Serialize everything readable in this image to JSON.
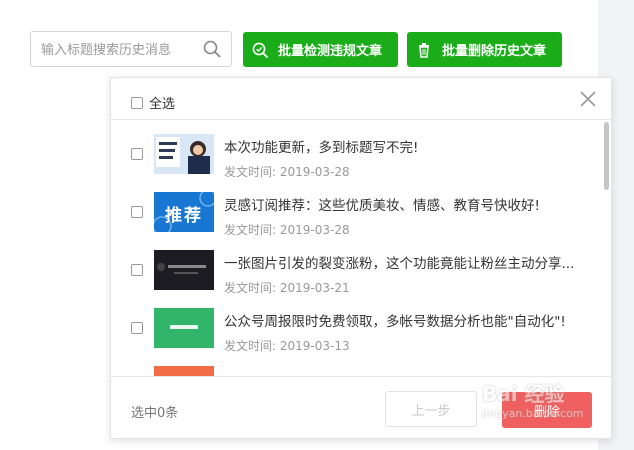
{
  "search": {
    "placeholder": "输入标题搜索历史消息"
  },
  "toolbar": {
    "detect_label": "批量检测违规文章",
    "delete_label": "批量删除历史文章"
  },
  "popup": {
    "select_all_label": "全选",
    "date_prefix": "发文时间: ",
    "items": [
      {
        "title": "本次功能更新，多到标题写不完!",
        "date": "发文时间: 2019-03-28",
        "thumb_text": ""
      },
      {
        "title": "灵感订阅推荐：这些优质美妆、情感、教育号快收好!",
        "date": "发文时间: 2019-03-28",
        "thumb_text": "推荐"
      },
      {
        "title": "一张图片引发的裂变涨粉，这个功能竟能让粉丝主动分享...",
        "date": "发文时间: 2019-03-21",
        "thumb_text": ""
      },
      {
        "title": "公众号周报限时免费领取，多帐号数据分析也能\"自动化\"!",
        "date": "发文时间: 2019-03-13",
        "thumb_text": ""
      }
    ],
    "footer": {
      "selected_count": "选中0条",
      "prev_label": "上一步",
      "delete_label": "删除"
    }
  },
  "watermark": {
    "text": "Bai 经验",
    "subtext": "jingyan.baidu.com"
  },
  "colors": {
    "green": "#1aad19",
    "red": "#f06060"
  }
}
